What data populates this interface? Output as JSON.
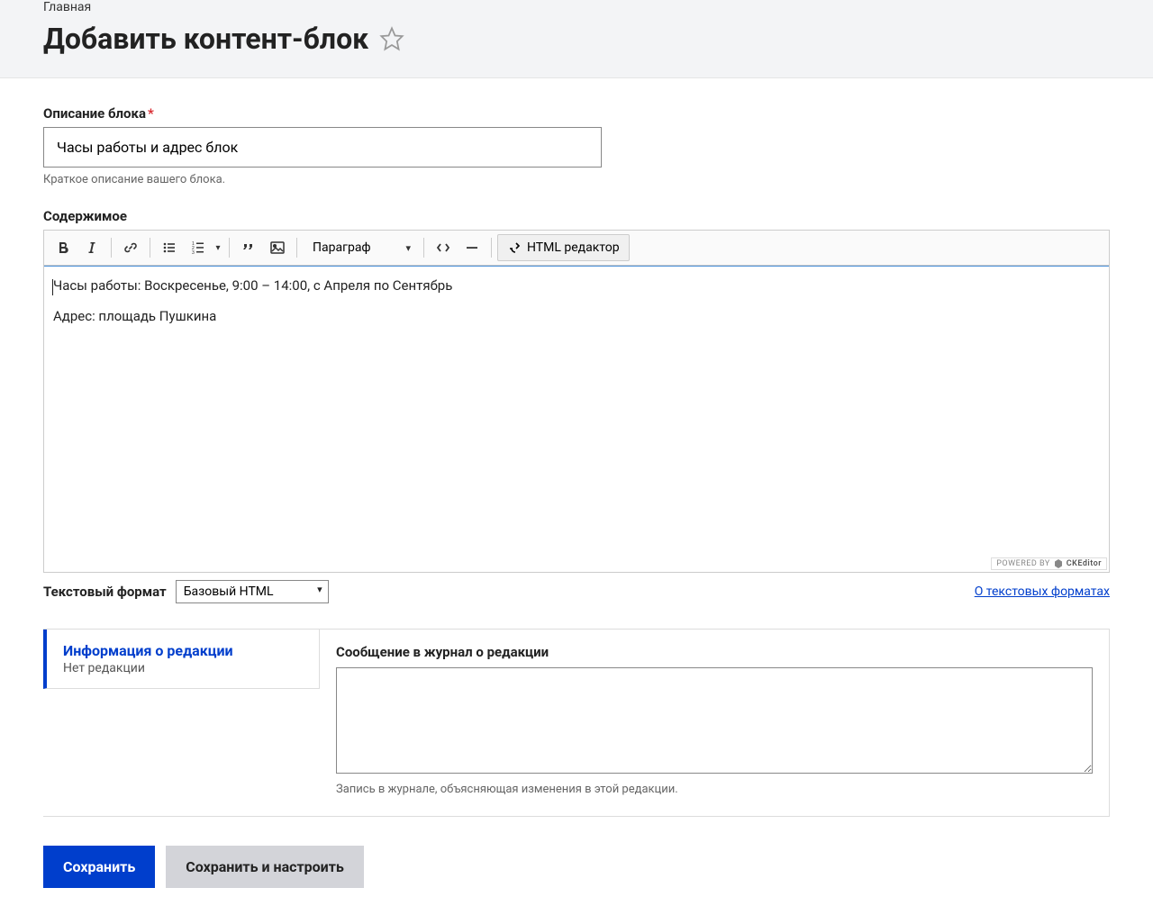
{
  "breadcrumb": "Главная",
  "page_title": "Добавить контент-блок",
  "description": {
    "label": "Описание блока",
    "value": "Часы работы и адрес блок",
    "helper": "Краткое описание вашего блока."
  },
  "content": {
    "label": "Содержимое",
    "toolbar": {
      "paragraph_select": "Параграф",
      "html_editor_btn": "HTML редактор"
    },
    "body_line1": "Часы работы: Воскресенье, 9:00 – 14:00, с Апреля по Сентябрь",
    "body_line2": "Адрес: площадь Пушкина",
    "powered_by": "POWERED BY",
    "powered_name": "CKEditor"
  },
  "text_format": {
    "label": "Текстовый формат",
    "selected": "Базовый HTML",
    "about_link": "О текстовых форматах"
  },
  "revision": {
    "tab_title": "Информация о редакции",
    "tab_sub": "Нет редакции",
    "field_label": "Сообщение в журнал о редакции",
    "field_value": "",
    "helper": "Запись в журнале, объясняющая изменения в этой редакции."
  },
  "buttons": {
    "save": "Сохранить",
    "save_configure": "Сохранить и настроить"
  }
}
